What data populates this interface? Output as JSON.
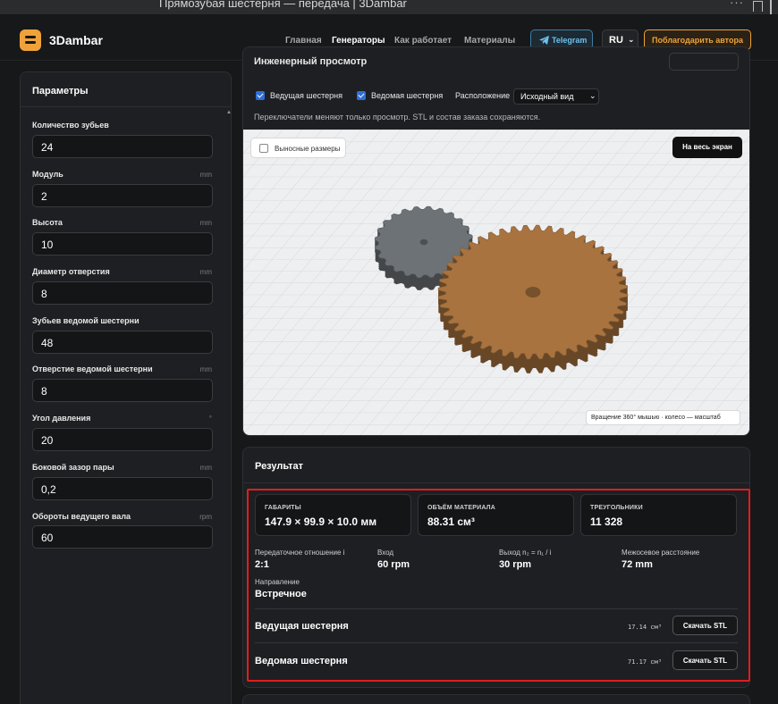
{
  "browser": {
    "tab_title": "Прямозубая шестерня — передача | 3Dambar"
  },
  "header": {
    "logo": "3Dambar",
    "nav": [
      "Главная",
      "Генераторы",
      "Как работает",
      "Материалы"
    ],
    "telegram": "Telegram",
    "lang": "RU",
    "thank": "Поблагодарить автора"
  },
  "params": {
    "title": "Параметры",
    "fields": [
      {
        "label": "Количество зубьев",
        "unit": "",
        "value": "24"
      },
      {
        "label": "Модуль",
        "unit": "mm",
        "value": "2"
      },
      {
        "label": "Высота",
        "unit": "mm",
        "value": "10"
      },
      {
        "label": "Диаметр отверстия",
        "unit": "mm",
        "value": "8"
      },
      {
        "label": "Зубьев ведомой шестерни",
        "unit": "",
        "value": "48"
      },
      {
        "label": "Отверстие ведомой шестерни",
        "unit": "mm",
        "value": "8"
      },
      {
        "label": "Угол давления",
        "unit": "°",
        "value": "20"
      },
      {
        "label": "Боковой зазор пары",
        "unit": "mm",
        "value": "0,2"
      },
      {
        "label": "Обороты ведущего вала",
        "unit": "rpm",
        "value": "60"
      }
    ]
  },
  "viewer": {
    "title": "Инженерный просмотр",
    "drive_label": "Ведущая шестерня",
    "driven_label": "Ведомая шестерня",
    "layout_label": "Расположение",
    "layout_value": "Исходный вид",
    "note": "Переключатели меняют только просмотр. STL и состав заказа сохраняются.",
    "dims_toggle": "Выносные размеры",
    "fullscreen": "На весь экран",
    "hint": "Вращение 360° мышью · колесо — масштаб",
    "colors": {
      "drive_gear": "#6d7276",
      "driven_gear": "#a8733f"
    }
  },
  "result": {
    "title": "Результат",
    "stats": [
      {
        "label": "ГАБАРИТЫ",
        "value": "147.9 × 99.9 × 10.0 мм"
      },
      {
        "label": "ОБЪЁМ МАТЕРИАЛА",
        "value": "88.31 см³"
      },
      {
        "label": "ТРЕУГОЛЬНИКИ",
        "value": "11 328"
      }
    ],
    "metrics": [
      {
        "label": "Передаточное отношение i",
        "value": "2:1"
      },
      {
        "label": "Вход",
        "value": "60 rpm"
      },
      {
        "label": "Выход n₂ = n₁ / i",
        "value": "30 rpm"
      },
      {
        "label": "Межосевое расстояние",
        "value": "72 mm"
      }
    ],
    "direction": {
      "label": "Направление",
      "value": "Встречное"
    },
    "gears": [
      {
        "name": "Ведущая шестерня",
        "volume": "17.14 см³",
        "button": "Скачать STL"
      },
      {
        "name": "Ведомая шестерня",
        "volume": "71.17 см³",
        "button": "Скачать STL"
      }
    ]
  }
}
